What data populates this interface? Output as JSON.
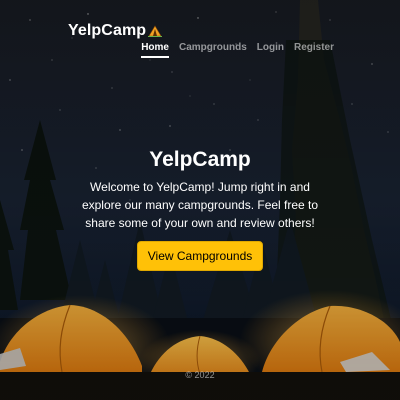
{
  "header": {
    "brand": "YelpCamp",
    "brand_icon": "tent-icon"
  },
  "nav": {
    "items": [
      {
        "label": "Home",
        "active": true
      },
      {
        "label": "Campgrounds",
        "active": false
      },
      {
        "label": "Login",
        "active": false
      },
      {
        "label": "Register",
        "active": false
      }
    ]
  },
  "hero": {
    "title": "YelpCamp",
    "lead": "Welcome to YelpCamp! Jump right in and explore our many campgrounds. Feel free to share some of your own and review others!",
    "cta_label": "View Campgrounds"
  },
  "footer": {
    "copyright": "© 2022"
  },
  "colors": {
    "accent": "#ffc107",
    "sky": "#0b1220",
    "tent": "#f2a224"
  }
}
